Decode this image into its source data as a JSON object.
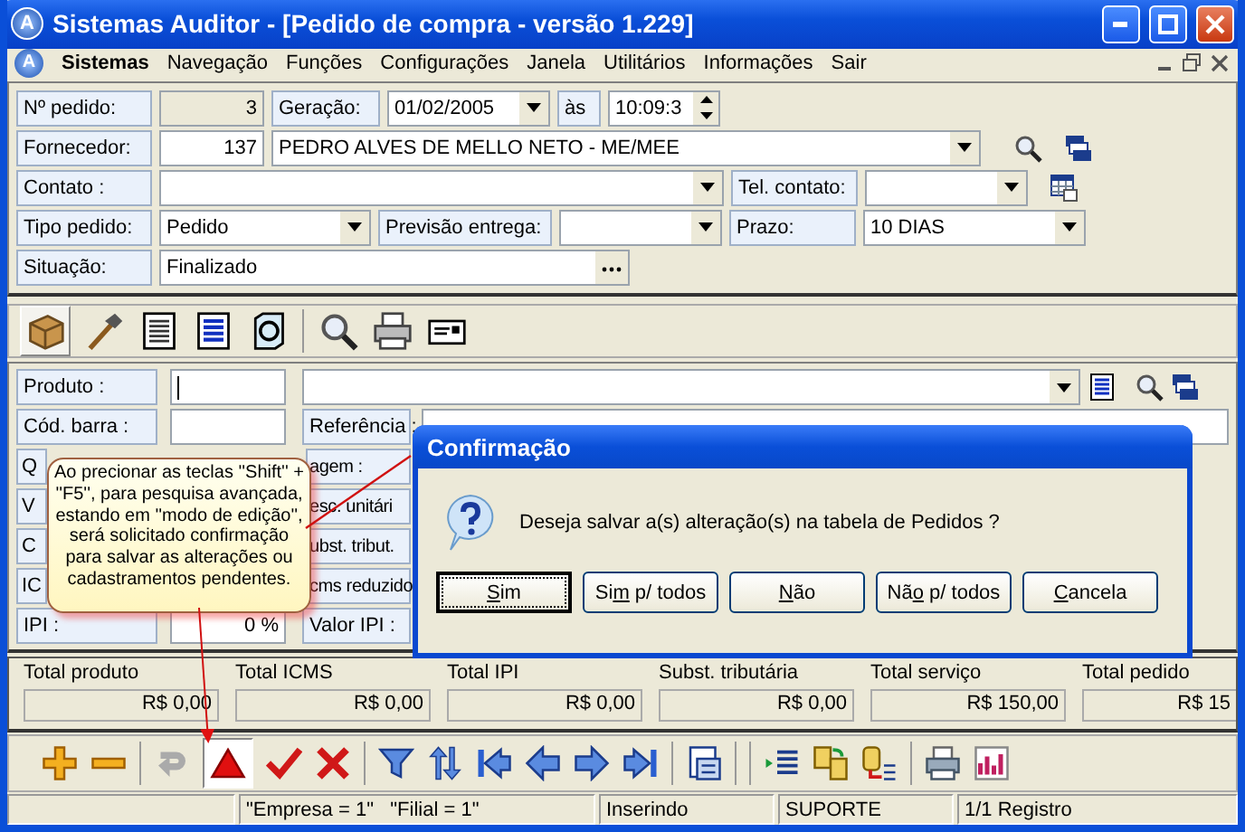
{
  "window": {
    "logo": "A",
    "title": "Sistemas Auditor - [Pedido de compra - versão 1.229]"
  },
  "menu": {
    "logo": "A",
    "items": [
      "Sistemas",
      "Navegação",
      "Funções",
      "Configurações",
      "Janela",
      "Utilitários",
      "Informações",
      "Sair"
    ]
  },
  "header": {
    "order_number": {
      "label": "Nº pedido:",
      "value": "3"
    },
    "generation": {
      "label": "Geração:",
      "date": "01/02/2005",
      "at_label": "às",
      "time": "10:09:3"
    },
    "supplier": {
      "label": "Fornecedor:",
      "code": "137",
      "name": "PEDRO ALVES DE MELLO NETO - ME/MEE"
    },
    "contact": {
      "label": "Contato :"
    },
    "phone": {
      "label": "Tel. contato:"
    },
    "order_type": {
      "label": "Tipo pedido:",
      "value": "Pedido"
    },
    "delivery": {
      "label": "Previsão entrega:"
    },
    "term": {
      "label": "Prazo:",
      "value": "10 DIAS"
    },
    "status": {
      "label": "Situação:",
      "value": "Finalizado"
    }
  },
  "product": {
    "product_label": "Produto :",
    "barcode_label": "Cód. barra :",
    "reference_label": "Referência :",
    "left_labels": [
      "Q",
      "V",
      "C",
      "IC"
    ],
    "middle_labels": [
      "agem :",
      "esc. unitári",
      "ubst. tribut.",
      "cms reduzido"
    ],
    "ipi_label": "IPI :",
    "ipi_value": "0 %",
    "ipi_value_label": "Valor IPI :"
  },
  "totals": [
    {
      "label": "Total produto",
      "value": "R$ 0,00"
    },
    {
      "label": "Total ICMS",
      "value": "R$ 0,00"
    },
    {
      "label": "Total IPI",
      "value": "R$ 0,00"
    },
    {
      "label": "Subst. tributária",
      "value": "R$ 0,00"
    },
    {
      "label": "Total serviço",
      "value": "R$ 150,00"
    },
    {
      "label": "Total pedido",
      "value": "R$ 15"
    }
  ],
  "status_bar": [
    "\"Empresa = 1\"   \"Filial = 1\"",
    "Inserindo",
    "SUPORTE",
    "1/1 Registro"
  ],
  "dialog": {
    "title": "Confirmação",
    "message": "Deseja salvar a(s) alteração(s) na tabela de Pedidos ?",
    "buttons": [
      {
        "key": "S",
        "after": "im",
        "focused": true
      },
      {
        "before": "Si",
        "key": "m",
        "after": " p/ todos",
        "focused": false
      },
      {
        "key": "N",
        "after": "ão",
        "focused": false
      },
      {
        "before": "Nã",
        "key": "o",
        "after": " p/ todos",
        "focused": false
      },
      {
        "key": "C",
        "after": "ancela",
        "focused": false
      }
    ]
  },
  "callout": {
    "text": "Ao precionar as teclas ''Shift'' + ''F5'', para pesquisa avançada, estando em ''modo de edição'', será solicitado confirmação para salvar as alterações ou cadastramentos pendentes."
  }
}
